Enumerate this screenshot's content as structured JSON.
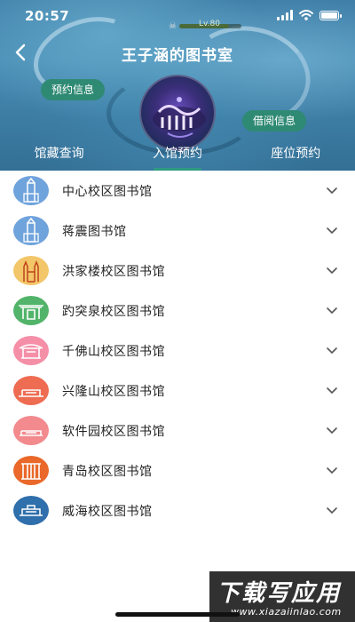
{
  "status_bar": {
    "time": "20:57"
  },
  "level": {
    "label": "Lv.80",
    "progress": 0.8
  },
  "header": {
    "title": "王子涵的图书室",
    "reserve_info": "预约信息",
    "borrow_info": "借阅信息"
  },
  "tabs": [
    {
      "label": "馆藏查询",
      "active": false
    },
    {
      "label": "入馆预约",
      "active": true
    },
    {
      "label": "座位预约",
      "active": false
    }
  ],
  "libraries": [
    {
      "label": "中心校区图书馆",
      "icon": "tower-building-icon",
      "color": "#6fa3dc"
    },
    {
      "label": "蒋震图书馆",
      "icon": "tower-building-icon",
      "color": "#6fa3dc"
    },
    {
      "label": "洪家楼校区图书馆",
      "icon": "church-icon",
      "color": "#f3c669"
    },
    {
      "label": "趵突泉校区图书馆",
      "icon": "gate-icon",
      "color": "#52b46a"
    },
    {
      "label": "千佛山校区图书馆",
      "icon": "pavilion-icon",
      "color": "#f58fa8"
    },
    {
      "label": "兴隆山校区图书馆",
      "icon": "hall-icon",
      "color": "#ee6c52"
    },
    {
      "label": "软件园校区图书馆",
      "icon": "campus-building-icon",
      "color": "#f28a8e"
    },
    {
      "label": "青岛校区图书馆",
      "icon": "colonnade-icon",
      "color": "#e9682a"
    },
    {
      "label": "威海校区图书馆",
      "icon": "ship-building-icon",
      "color": "#2f6fab"
    }
  ],
  "colors": {
    "accent": "#2f8a74",
    "tab_underline": "#2f9a80",
    "header_blue": "#3f7fa8"
  },
  "watermark": {
    "main": "下载写应用",
    "sub": "www.xiazaiinlao.com"
  }
}
